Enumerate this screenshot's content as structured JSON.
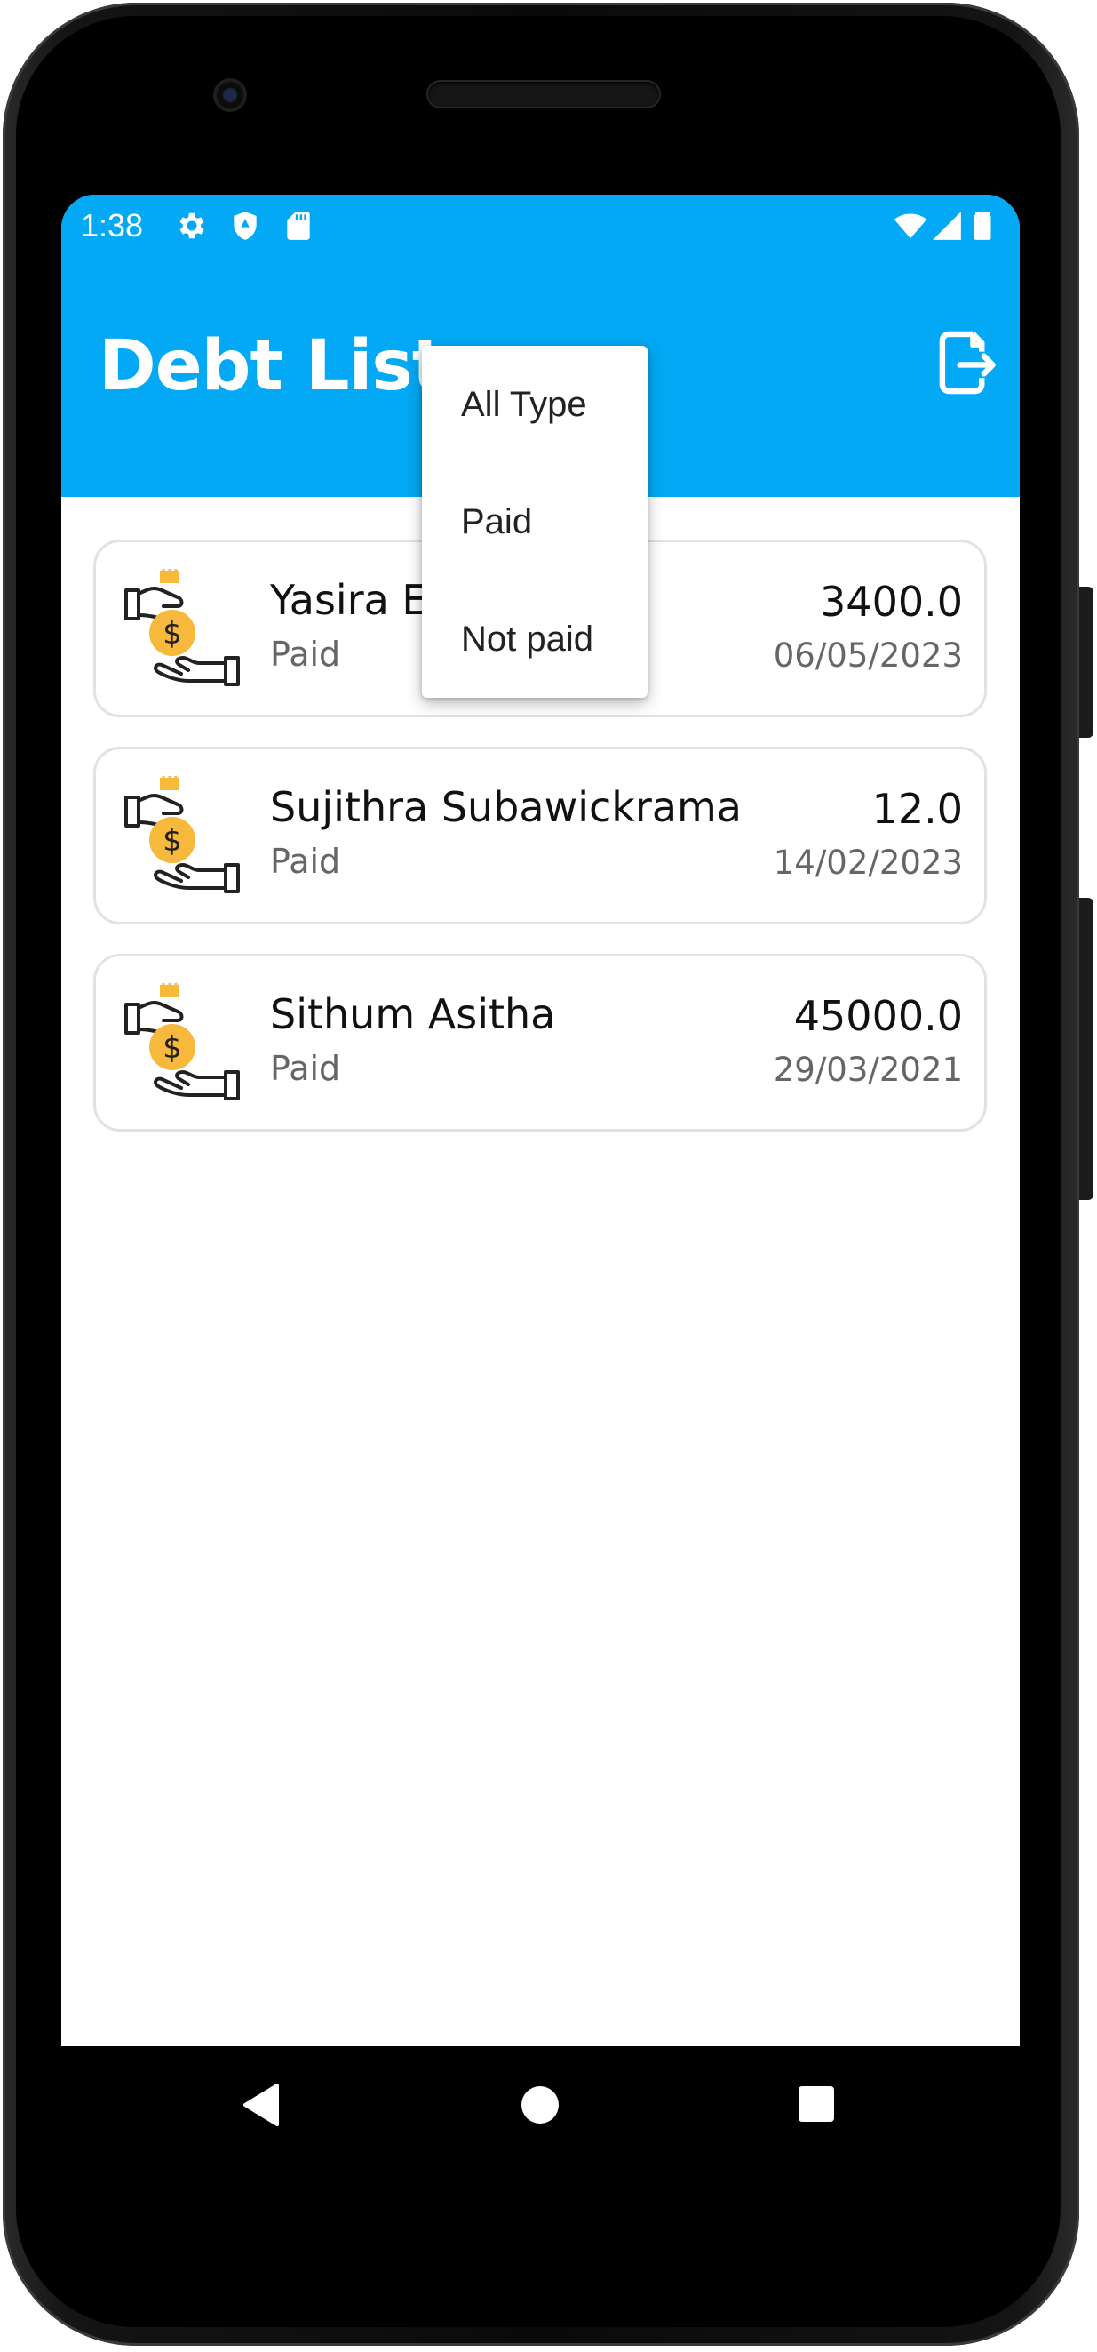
{
  "status_bar": {
    "time": "1:38",
    "left_icons": [
      "gear-icon",
      "shield-icon",
      "sd-card-icon"
    ],
    "right_icons": [
      "wifi-icon",
      "signal-icon",
      "battery-icon"
    ]
  },
  "appbar": {
    "title": "Debt List",
    "action_icon": "file-export-icon",
    "color": "#03a9f4"
  },
  "filter_menu": {
    "items": [
      "All Type",
      "Paid",
      "Not paid"
    ]
  },
  "debts": [
    {
      "name": "Yasira E",
      "status": "Paid",
      "amount": "3400.0",
      "date": "06/05/2023",
      "icon": "money-hand-icon"
    },
    {
      "name": "Sujithra Subawickrama",
      "status": "Paid",
      "amount": "12.0",
      "date": "14/02/2023",
      "icon": "money-hand-icon"
    },
    {
      "name": "Sithum Asitha",
      "status": "Paid",
      "amount": "45000.0",
      "date": "29/03/2021",
      "icon": "money-hand-icon"
    }
  ],
  "nav_bar": {
    "buttons": [
      "back-icon",
      "home-icon",
      "recents-icon"
    ]
  }
}
